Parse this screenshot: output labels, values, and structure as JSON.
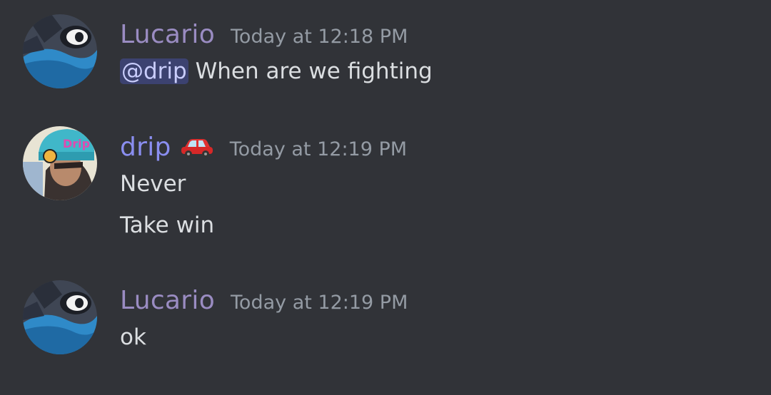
{
  "messages": [
    {
      "author": "Lucario",
      "timestamp": "Today at 12:18 PM",
      "mention": "@drip",
      "text": " When are we fighting"
    },
    {
      "author": "drip",
      "author_emoji": "car-emoji",
      "timestamp": "Today at 12:19 PM",
      "lines": [
        "Never",
        "Take win"
      ]
    },
    {
      "author": "Lucario",
      "timestamp": "Today at 12:19 PM",
      "text": "ok"
    }
  ],
  "colors": {
    "background": "#313338",
    "lucario_name": "#9a8cc2",
    "drip_name": "#8a8ef0",
    "timestamp": "#949ba4",
    "message_text": "#dbdee1",
    "mention_bg": "#3c4270"
  }
}
